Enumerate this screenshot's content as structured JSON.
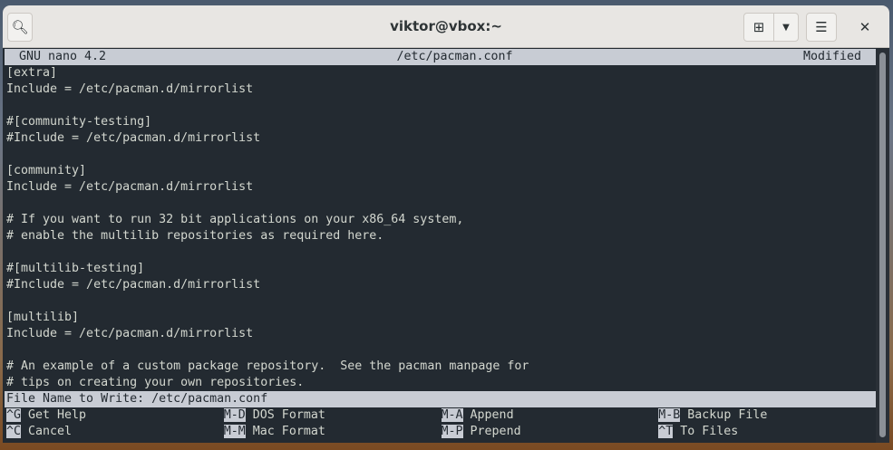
{
  "window": {
    "title": "viktor@vbox:~",
    "search_icon": "search-icon",
    "new_tab_icon": "new-tab-icon",
    "menu_icon": "hamburger-icon",
    "close_icon": "close-icon"
  },
  "nano": {
    "version": "GNU nano 4.2",
    "filename": "/etc/pacman.conf",
    "state": "Modified",
    "lines": [
      "[extra]",
      "Include = /etc/pacman.d/mirrorlist",
      "",
      "#[community-testing]",
      "#Include = /etc/pacman.d/mirrorlist",
      "",
      "[community]",
      "Include = /etc/pacman.d/mirrorlist",
      "",
      "# If you want to run 32 bit applications on your x86_64 system,",
      "# enable the multilib repositories as required here.",
      "",
      "#[multilib-testing]",
      "#Include = /etc/pacman.d/mirrorlist",
      "",
      "[multilib]",
      "Include = /etc/pacman.d/mirrorlist",
      "",
      "# An example of a custom package repository.  See the pacman manpage for",
      "# tips on creating your own repositories."
    ],
    "prompt": "File Name to Write: /etc/pacman.conf",
    "shortcuts": [
      [
        {
          "key": "^G",
          "label": " Get Help"
        },
        {
          "key": "M-D",
          "label": " DOS Format"
        },
        {
          "key": "M-A",
          "label": " Append"
        },
        {
          "key": "M-B",
          "label": " Backup File"
        }
      ],
      [
        {
          "key": "^C",
          "label": " Cancel"
        },
        {
          "key": "M-M",
          "label": " Mac Format"
        },
        {
          "key": "M-P",
          "label": " Prepend"
        },
        {
          "key": "^T",
          "label": " To Files"
        }
      ]
    ]
  }
}
